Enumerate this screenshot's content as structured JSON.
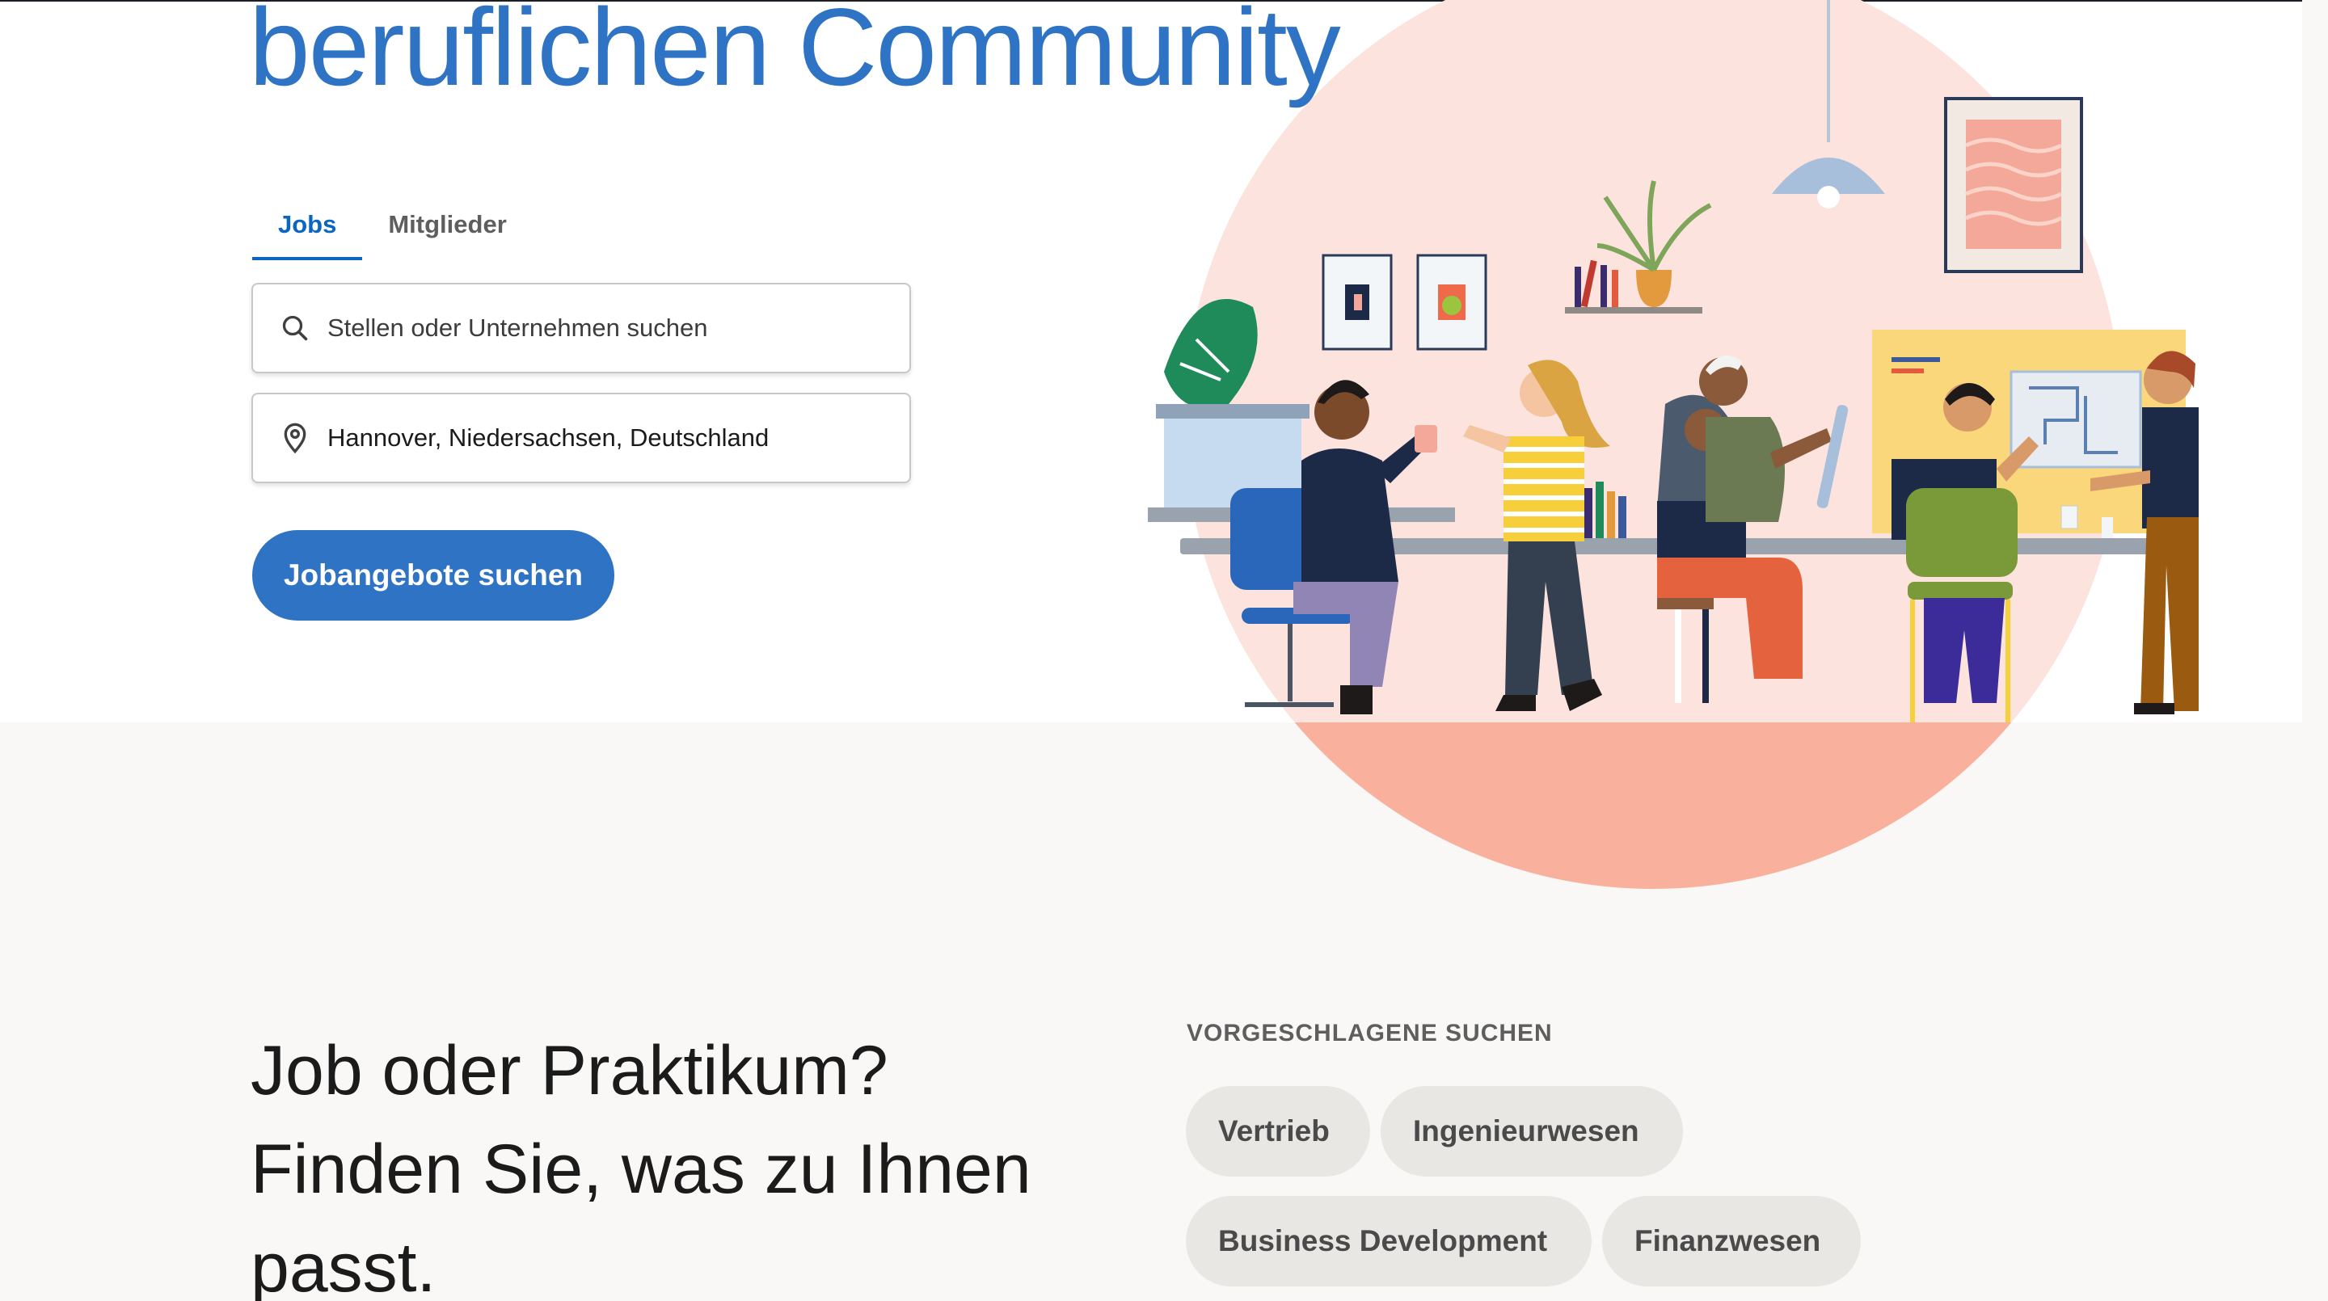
{
  "hero": {
    "headline": "beruflichen Community",
    "accent_color": "#2f73c4"
  },
  "tabs": [
    {
      "label": "Jobs",
      "active": true
    },
    {
      "label": "Mitglieder",
      "active": false
    }
  ],
  "search": {
    "keyword_placeholder": "Stellen oder Unternehmen suchen",
    "location_value": "Hannover, Niedersachsen, Deutschland",
    "submit_label": "Jobangebote suchen"
  },
  "section": {
    "title_line1": "Job oder Praktikum?",
    "title_line2": "Finden Sie, was zu Ihnen",
    "title_line3": "passt."
  },
  "suggested": {
    "label": "VORGESCHLAGENE SUCHEN",
    "items": [
      "Vertrieb",
      "Ingenieurwesen",
      "Business Development",
      "Finanzwesen"
    ]
  },
  "icons": {
    "search": "search-icon",
    "location": "location-pin-icon"
  }
}
